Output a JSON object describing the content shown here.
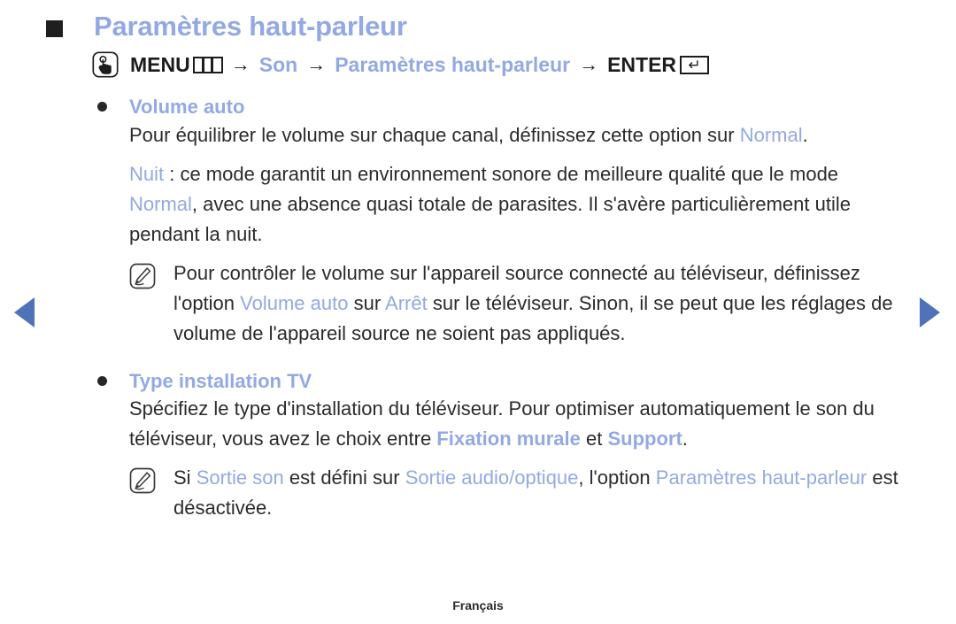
{
  "page": {
    "heading": "Paramètres haut-parleur",
    "footer": "Français",
    "accent_blue": "#93a9e2",
    "arrow_blue": "#4f72b8",
    "text_color": "#2b2b2b"
  },
  "nav": {
    "prev_label": "Page précédente",
    "next_label": "Page suivante"
  },
  "menu_path": {
    "touch_icon": "touch-hand-icon",
    "menu_label": "MENU",
    "menu_key_icon": "menu-key-icon",
    "arrow1": "→",
    "item1": "Son",
    "arrow2": "→",
    "item2": "Paramètres haut-parleur",
    "arrow3": "→",
    "enter_label": "ENTER",
    "enter_key_icon": "enter-key-icon",
    "enter_key_glyph": "↵"
  },
  "sections": [
    {
      "title": "Volume auto",
      "paragraphs": [
        {
          "parts": [
            {
              "text": "Pour équilibrer le volume sur chaque canal, définissez cette option sur ",
              "style": "normal"
            },
            {
              "text": "Normal",
              "style": "blue"
            },
            {
              "text": ".",
              "style": "normal"
            }
          ]
        },
        {
          "parts": [
            {
              "text": "Nuit",
              "style": "blue"
            },
            {
              "text": " : ce mode garantit un environnement sonore de meilleure qualité que le mode ",
              "style": "normal"
            },
            {
              "text": "Normal",
              "style": "blue"
            },
            {
              "text": ", avec une absence quasi totale de parasites. Il s'avère particulièrement utile pendant la nuit.",
              "style": "normal"
            }
          ]
        }
      ],
      "notes": [
        {
          "icon": "note-pencil-icon",
          "parts": [
            {
              "text": "Pour contrôler le volume sur l'appareil source connecté au téléviseur, définissez l'option ",
              "style": "normal"
            },
            {
              "text": "Volume auto",
              "style": "blue"
            },
            {
              "text": " sur ",
              "style": "normal"
            },
            {
              "text": "Arrêt",
              "style": "blue"
            },
            {
              "text": " sur le téléviseur. Sinon, il se peut que les réglages de volume de l'appareil source ne soient pas appliqués.",
              "style": "normal"
            }
          ]
        }
      ]
    },
    {
      "title": "Type installation TV",
      "paragraphs": [
        {
          "parts": [
            {
              "text": "Spécifiez le type d'installation du téléviseur. Pour optimiser automatiquement le son du téléviseur, vous avez le choix entre ",
              "style": "normal"
            },
            {
              "text": "Fixation murale",
              "style": "blue-bold"
            },
            {
              "text": " et ",
              "style": "normal"
            },
            {
              "text": "Support",
              "style": "blue-bold"
            },
            {
              "text": ".",
              "style": "normal"
            }
          ]
        }
      ],
      "notes": [
        {
          "icon": "note-pencil-icon",
          "parts": [
            {
              "text": "Si ",
              "style": "normal"
            },
            {
              "text": "Sortie son",
              "style": "blue"
            },
            {
              "text": " est défini sur ",
              "style": "normal"
            },
            {
              "text": "Sortie audio/optique",
              "style": "blue"
            },
            {
              "text": ", l'option ",
              "style": "normal"
            },
            {
              "text": "Paramètres haut-parleur",
              "style": "blue"
            },
            {
              "text": " est désactivée.",
              "style": "normal"
            }
          ]
        }
      ]
    }
  ]
}
